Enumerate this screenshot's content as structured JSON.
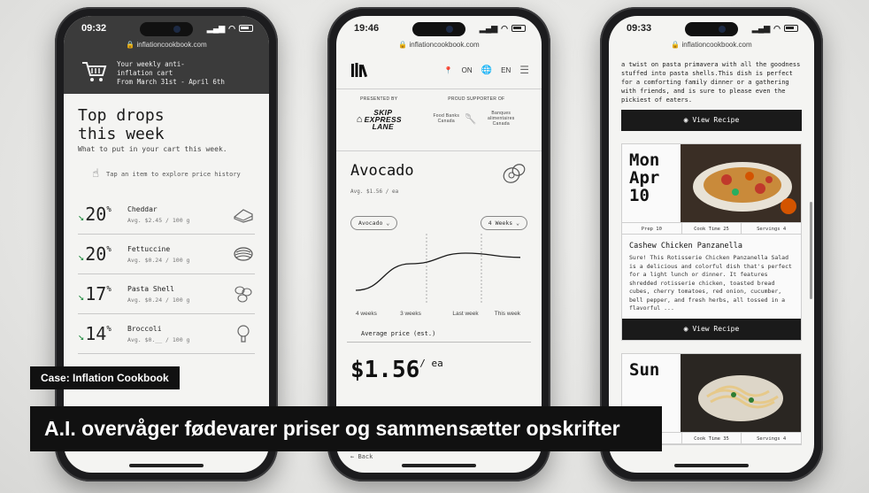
{
  "phone1": {
    "time": "09:32",
    "url": "inflationcookbook.com",
    "cart_text": [
      "Your weekly anti-",
      "inflation cart",
      "From March 31st - April 6th"
    ],
    "title_line1": "Top drops",
    "title_line2": "this week",
    "subtitle": "What to put in your cart this week.",
    "tap_hint": "Tap an item to explore price history",
    "items": [
      {
        "pct": "20",
        "name": "Cheddar",
        "avg": "Avg. $2.45 / 100 g",
        "icon": "cheese-icon"
      },
      {
        "pct": "20",
        "name": "Fettuccine",
        "avg": "Avg. $0.24 / 100 g",
        "icon": "pasta-nest-icon"
      },
      {
        "pct": "17",
        "name": "Pasta Shell",
        "avg": "Avg. $0.24 / 100 g",
        "icon": "pasta-shell-icon"
      },
      {
        "pct": "14",
        "name": "Broccoli",
        "avg": "Avg. $0.__ / 100 g",
        "icon": "broccoli-icon"
      }
    ]
  },
  "phone2": {
    "time": "19:46",
    "url": "inflationcookbook.com",
    "lang_on": "ON",
    "lang_en": "EN",
    "presented_by": "PRESENTED BY",
    "supporter_of": "PROUD SUPPORTER OF",
    "sponsor_name": [
      "SKIP",
      "EXPRESS",
      "LANE"
    ],
    "food_banks": "Food Banks Canada",
    "banques": "Banques alimentaires Canada",
    "item_title": "Avocado",
    "item_avg": "Avg. $1.56 / ea",
    "select_item": "Avocado",
    "select_range": "4 Weeks",
    "x_labels": [
      "4 weeks",
      "3 weeks",
      "Last week",
      "This week"
    ],
    "avg_price_label": "Average price (est.)",
    "price": "$1.56",
    "price_unit": "/ ea",
    "back": "Back"
  },
  "phone3": {
    "time": "09:33",
    "url": "inflationcookbook.com",
    "intro_text": "a twist on pasta primavera with all the goodness stuffed into pasta shells.This dish is perfect for a comforting family dinner or a gathering with friends, and is sure to please even the pickiest of eaters.",
    "view_recipe": "View Recipe",
    "card1": {
      "day": "Mon",
      "month": "Apr",
      "date": "10",
      "prep": "Prep 10",
      "cook": "Cook Time 25",
      "servings": "Servings 4",
      "title": "Cashew Chicken Panzanella",
      "desc": "Sure! This Rotisserie Chicken Panzanella Salad is a delicious and colorful dish that's perfect for a light lunch or dinner. It features shredded rotisserie chicken, toasted bread cubes, cherry tomatoes, red onion, cucumber, bell pepper, and fresh herbs, all tossed in a flavorful ..."
    },
    "card2": {
      "day": "Sun",
      "cook": "Cook Time 35",
      "servings": "Servings 4"
    }
  },
  "chart_data": {
    "type": "line",
    "categories": [
      "4 weeks",
      "3 weeks",
      "Last week",
      "This week"
    ],
    "series": [
      {
        "values": [
          1.25,
          1.5,
          1.6,
          1.56
        ]
      }
    ],
    "xlabel": "",
    "ylabel": "Average price (est.)"
  },
  "captions": {
    "case_tag": "Case: Inflation Cookbook",
    "headline": "A.I. overvåger fødevarer priser og sammensætter opskrifter"
  }
}
